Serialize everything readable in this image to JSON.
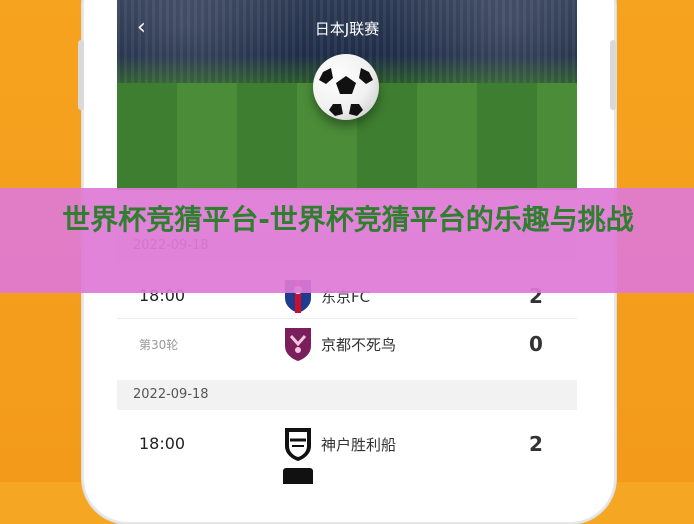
{
  "app": {
    "title": "日本J联赛"
  },
  "matches": [
    {
      "date": "2022-09-18",
      "time": "18:00",
      "round": "第30轮",
      "home_team": "东京FC",
      "away_team": "京都不死鸟",
      "home_score": "2",
      "away_score": "0"
    },
    {
      "date": "2022-09-18",
      "time": "18:00",
      "home_team": "神户胜利船",
      "home_score": "2"
    }
  ],
  "overlay": {
    "headline": "世界杯竞猜平台-世界杯竞猜平台的乐趣与挑战"
  },
  "colors": {
    "background": "#f5a623",
    "banner": "#de78d6",
    "headline_text": "#2f7f2f"
  }
}
